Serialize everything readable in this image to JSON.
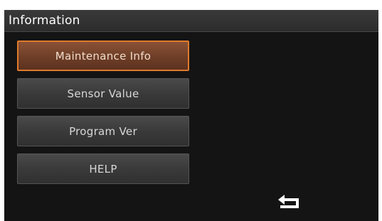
{
  "header": {
    "title": "Information"
  },
  "menu": {
    "items": [
      {
        "label": "Maintenance Info",
        "selected": true
      },
      {
        "label": "Sensor Value",
        "selected": false
      },
      {
        "label": "Program Ver",
        "selected": false
      },
      {
        "label": "HELP",
        "selected": false
      }
    ]
  },
  "footer": {
    "back_icon": "return-arrow-icon"
  },
  "colors": {
    "screen_background": "#141414",
    "title_bar": "#333333",
    "button": "#3c3c3c",
    "selected_button": "#6e3e27",
    "selected_border": "#e07a2c",
    "text": "#ffffff"
  }
}
